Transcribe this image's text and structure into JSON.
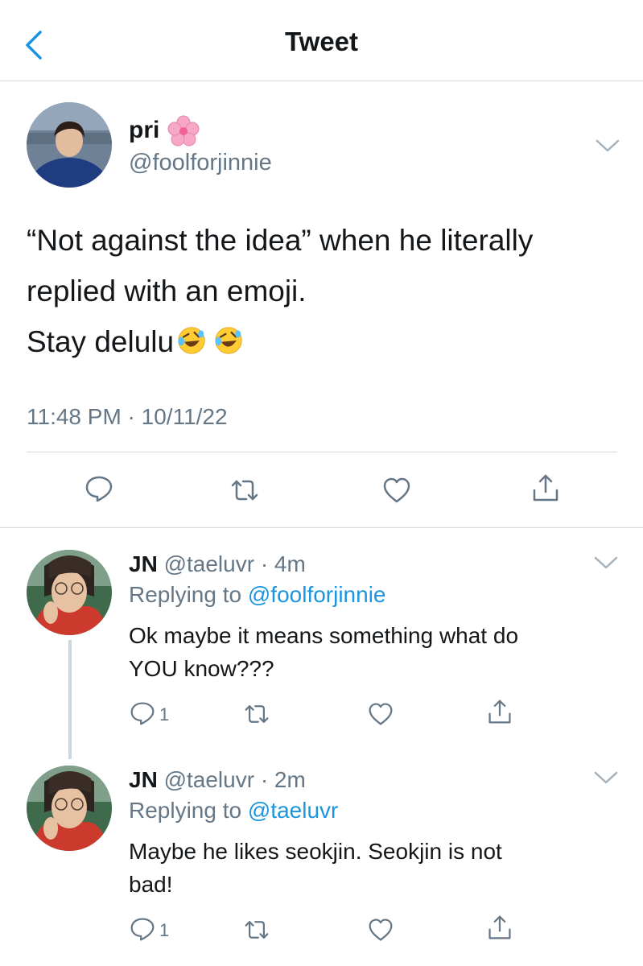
{
  "header": {
    "title": "Tweet"
  },
  "main_tweet": {
    "author_name": "pri",
    "author_handle": "@foolforjinnie",
    "lines": [
      "“Not against the idea” when he literally",
      "replied with an emoji.",
      "Stay delulu"
    ],
    "emoji_count": 2,
    "emoji_icon": "rolling-on-floor-laughing-emoji",
    "timestamp": "11:48 PM · 10/11/22"
  },
  "replies": [
    {
      "name": "JN",
      "handle": "@taeluvr",
      "time": "· 4m",
      "replying_prefix": "Replying to ",
      "replying_to": "@foolforjinnie",
      "lines": [
        "Ok maybe it means something what do",
        "YOU know???"
      ],
      "reply_count": "1"
    },
    {
      "name": "JN",
      "handle": "@taeluvr",
      "time": "· 2m",
      "replying_prefix": "Replying to ",
      "replying_to": "@taeluvr",
      "lines": [
        "Maybe he likes seokjin. Seokjin is not",
        "bad!"
      ],
      "reply_count": "1"
    }
  ],
  "colors": {
    "accent": "#1b95e0",
    "muted": "#657786",
    "text": "#14171a",
    "divider": "#d8d8d8"
  }
}
